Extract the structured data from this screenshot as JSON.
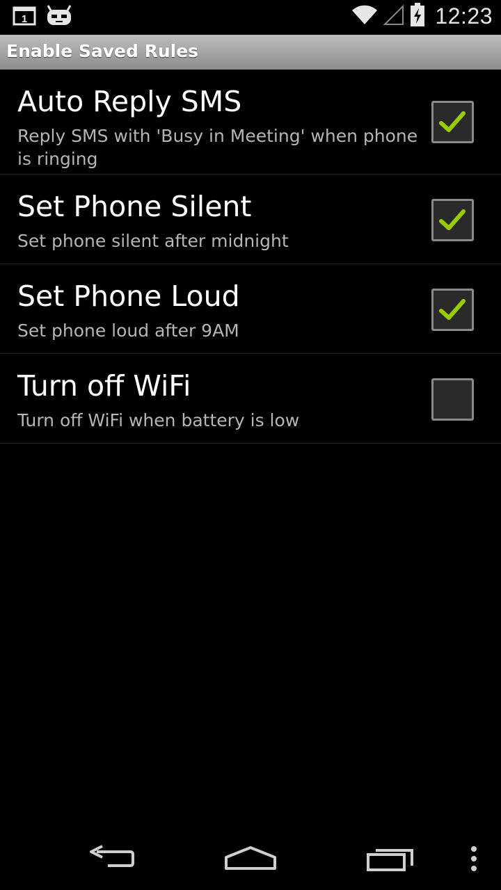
{
  "status_bar": {
    "time": "12:23",
    "icons": [
      "notification-calendar-icon",
      "cyanogenmod-android-icon",
      "wifi-icon",
      "signal-icon",
      "battery-charging-icon"
    ],
    "notification_calendar_text": "1"
  },
  "header": {
    "title": "Enable Saved Rules"
  },
  "rules": [
    {
      "title": "Auto Reply SMS",
      "summary": "Reply SMS with 'Busy in Meeting' when phone is ringing",
      "checked": true
    },
    {
      "title": "Set Phone Silent",
      "summary": "Set phone silent after midnight",
      "checked": true
    },
    {
      "title": "Set Phone Loud",
      "summary": "Set phone loud after 9AM",
      "checked": true
    },
    {
      "title": "Turn off WiFi",
      "summary": "Turn off WiFi when battery is low",
      "checked": false
    }
  ],
  "nav_bar": {
    "buttons": [
      "back-icon",
      "home-icon",
      "recent-apps-icon",
      "overflow-menu-icon"
    ]
  },
  "colors": {
    "background": "#000000",
    "check_accent": "#99cc00",
    "summary_text": "#b5b5b5",
    "header_gradient_top": "#bdbdbd",
    "header_gradient_bottom": "#8c8c8c"
  }
}
